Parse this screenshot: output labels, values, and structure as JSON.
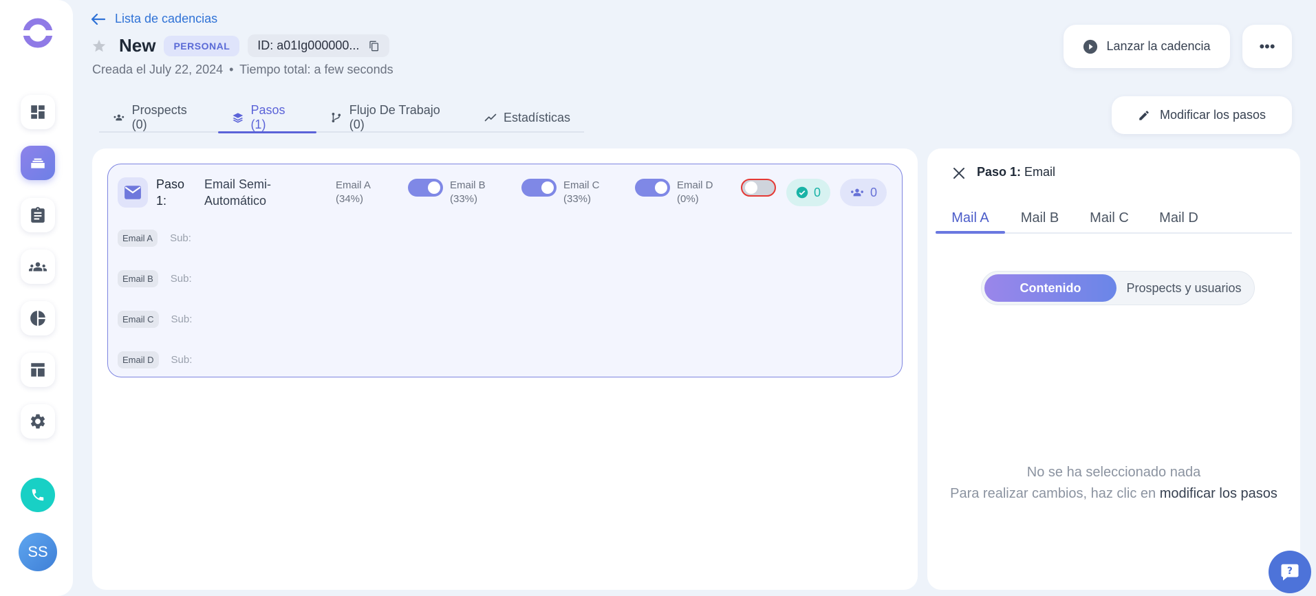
{
  "header": {
    "back_label": "Lista de cadencias",
    "title": "New",
    "badge": "PERSONAL",
    "id_text": "ID: a01Ig000000...",
    "created": "Creada el July 22, 2024",
    "separator": "•",
    "total_time": "Tiempo total: a few seconds",
    "launch_label": "Lanzar la cadencia",
    "more_label": "•••"
  },
  "tabs": [
    {
      "label": "Prospects (0)"
    },
    {
      "label": "Pasos (1)"
    },
    {
      "label": "Flujo De Trabajo (0)"
    },
    {
      "label": "Estadísticas"
    }
  ],
  "modify_label": "Modificar los pasos",
  "step": {
    "label": "Paso 1:",
    "type": "Email Semi-Automático",
    "variants": [
      {
        "name": "Email A",
        "pct": "(34%)"
      },
      {
        "name": "Email B",
        "pct": "(33%)"
      },
      {
        "name": "Email C",
        "pct": "(33%)"
      },
      {
        "name": "Email D",
        "pct": "(0%)"
      }
    ],
    "completed_count": "0",
    "prospects_count": "0",
    "emails": [
      {
        "tag": "Email A",
        "sub": "Sub:"
      },
      {
        "tag": "Email B",
        "sub": "Sub:"
      },
      {
        "tag": "Email C",
        "sub": "Sub:"
      },
      {
        "tag": "Email D",
        "sub": "Sub:"
      }
    ]
  },
  "detail": {
    "title_bold": "Paso 1:",
    "title_rest": "Email",
    "mail_tabs": [
      "Mail A",
      "Mail B",
      "Mail C",
      "Mail D"
    ],
    "segment_active": "Contenido",
    "segment_other": "Prospects y usuarios",
    "empty_line1": "No se ha seleccionado nada",
    "empty_line2": "Para realizar cambios, haz clic en",
    "empty_link": "modificar los pasos"
  },
  "user": {
    "initials": "SS"
  },
  "colors": {
    "accent": "#5b63d8",
    "toggle_on": "#7f88e6",
    "teal": "#18d0c5"
  }
}
